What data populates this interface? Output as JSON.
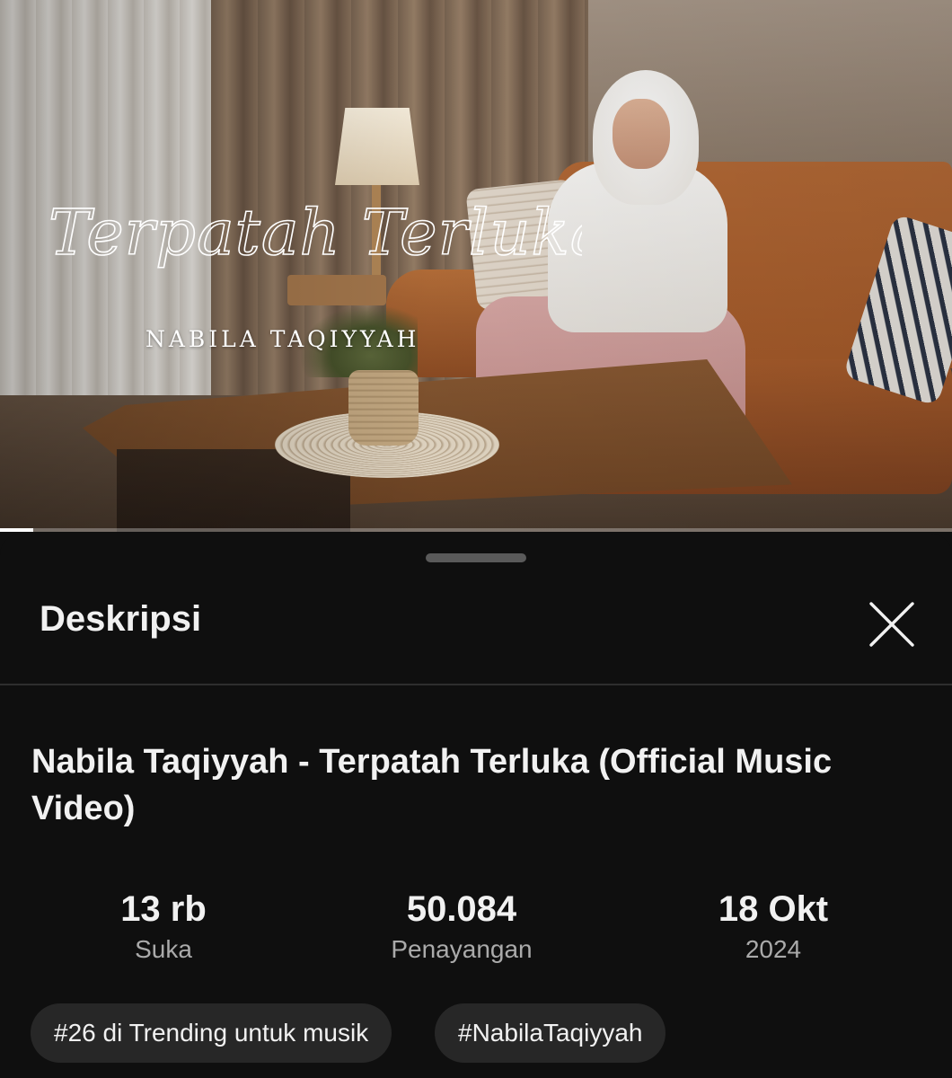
{
  "video": {
    "overlay_title": "Terpatah Terluka",
    "overlay_artist": "NABILA TAQIYYAH",
    "progress_fraction": 0.035
  },
  "sheet": {
    "title": "Deskripsi",
    "close_icon": "close-icon",
    "video_title": "Nabila Taqiyyah - Terpatah Terluka (Official Music Video)",
    "stats": [
      {
        "value": "13 rb",
        "label": "Suka"
      },
      {
        "value": "50.084",
        "label": "Penayangan"
      },
      {
        "value": "18 Okt",
        "label": "2024"
      }
    ],
    "chips": [
      {
        "label": "#26 di Trending untuk musik"
      },
      {
        "label": "#NabilaTaqiyyah"
      }
    ]
  },
  "colors": {
    "background": "#0f0f0f",
    "chip_background": "#272727",
    "secondary_text": "#aaaaaa"
  }
}
